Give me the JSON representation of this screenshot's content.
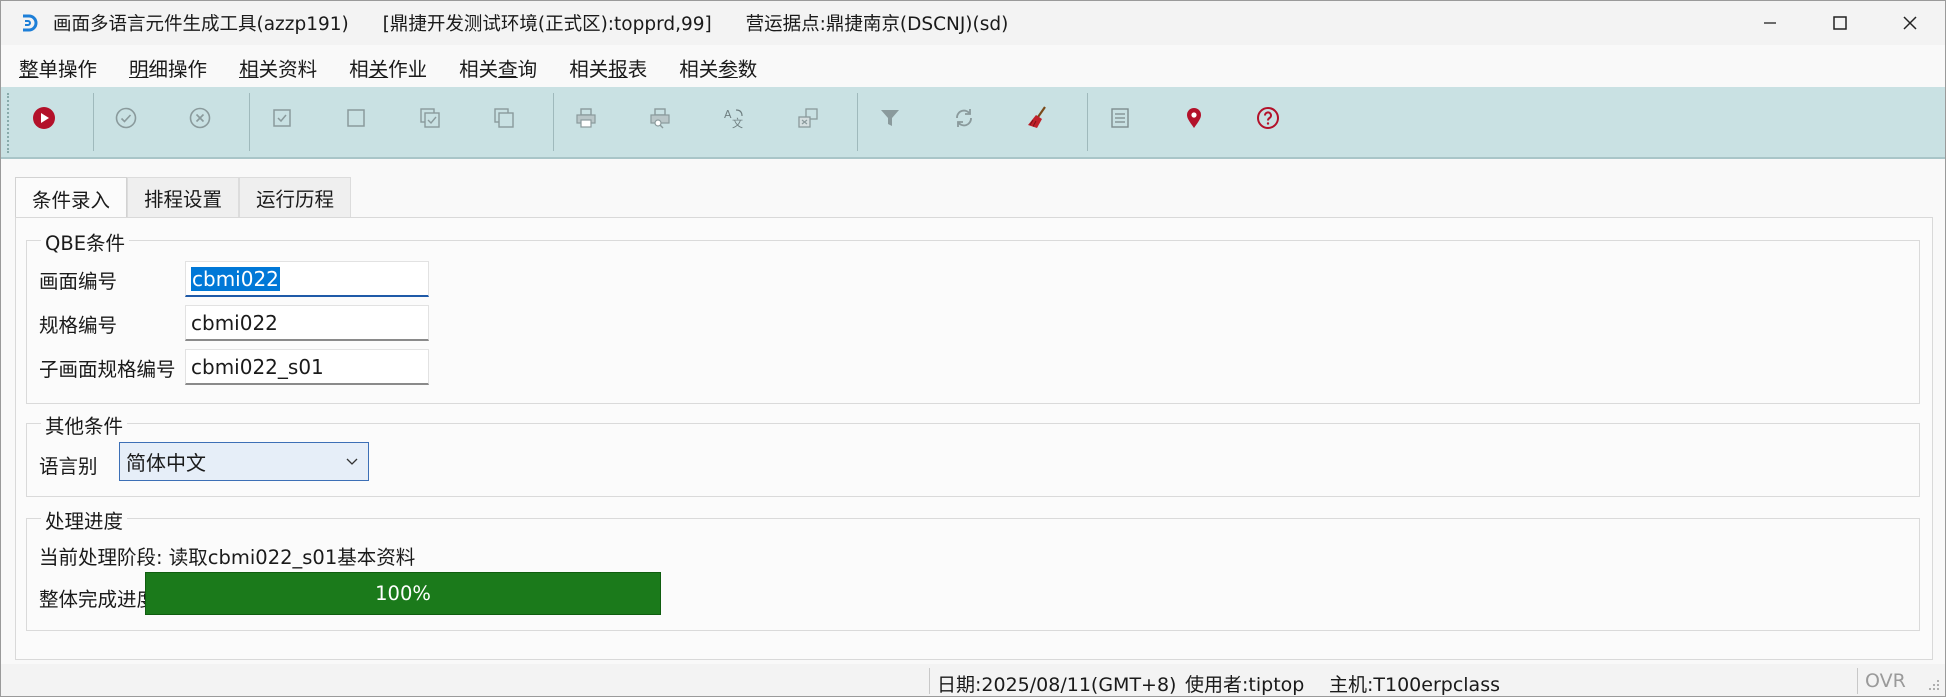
{
  "window": {
    "title_parts": [
      "画面多语言元件生成工具(azzp191)",
      "[鼎捷开发测试环境(正式区):topprd,99]",
      "营运据点:鼎捷南京(DSCNJ)(sd)"
    ]
  },
  "menu": [
    {
      "accel": "整",
      "rest": "单操作"
    },
    {
      "accel": "明",
      "rest": "细操作"
    },
    {
      "accel": "相",
      "rest": "关资料"
    },
    {
      "pre": "相",
      "accel": "关",
      "rest": "作业"
    },
    {
      "pre": "相关",
      "accel": "查",
      "rest": "询"
    },
    {
      "pre": "相关",
      "accel": "报",
      "rest": "表"
    },
    {
      "pre": "相关",
      "accel": "参",
      "rest": "数"
    }
  ],
  "tabs": [
    "条件录入",
    "排程设置",
    "运行历程"
  ],
  "qbe": {
    "title": "QBE条件",
    "screen_no_label": "画面编号",
    "screen_no_value": "cbmi022",
    "spec_no_label": "规格编号",
    "spec_no_value": "cbmi022",
    "sub_spec_label": "子画面规格编号",
    "sub_spec_value": "cbmi022_s01"
  },
  "other": {
    "title": "其他条件",
    "lang_label": "语言别",
    "lang_value": "简体中文"
  },
  "progress": {
    "title": "处理进度",
    "stage_label": "当前处理阶段:",
    "stage_value": "读取cbmi022_s01基本资料",
    "overall_label": "整体完成进度:",
    "percent_text": "100%",
    "percent": 100
  },
  "status": {
    "date": "日期:2025/08/11(GMT+8)",
    "user": "使用者:tiptop",
    "host": "主机:T100erpclass",
    "mode": "OVR"
  },
  "colors": {
    "toolbar_bg": "#c9e1e3",
    "progress_fill": "#1b7a1b",
    "accent": "#0078d7"
  }
}
